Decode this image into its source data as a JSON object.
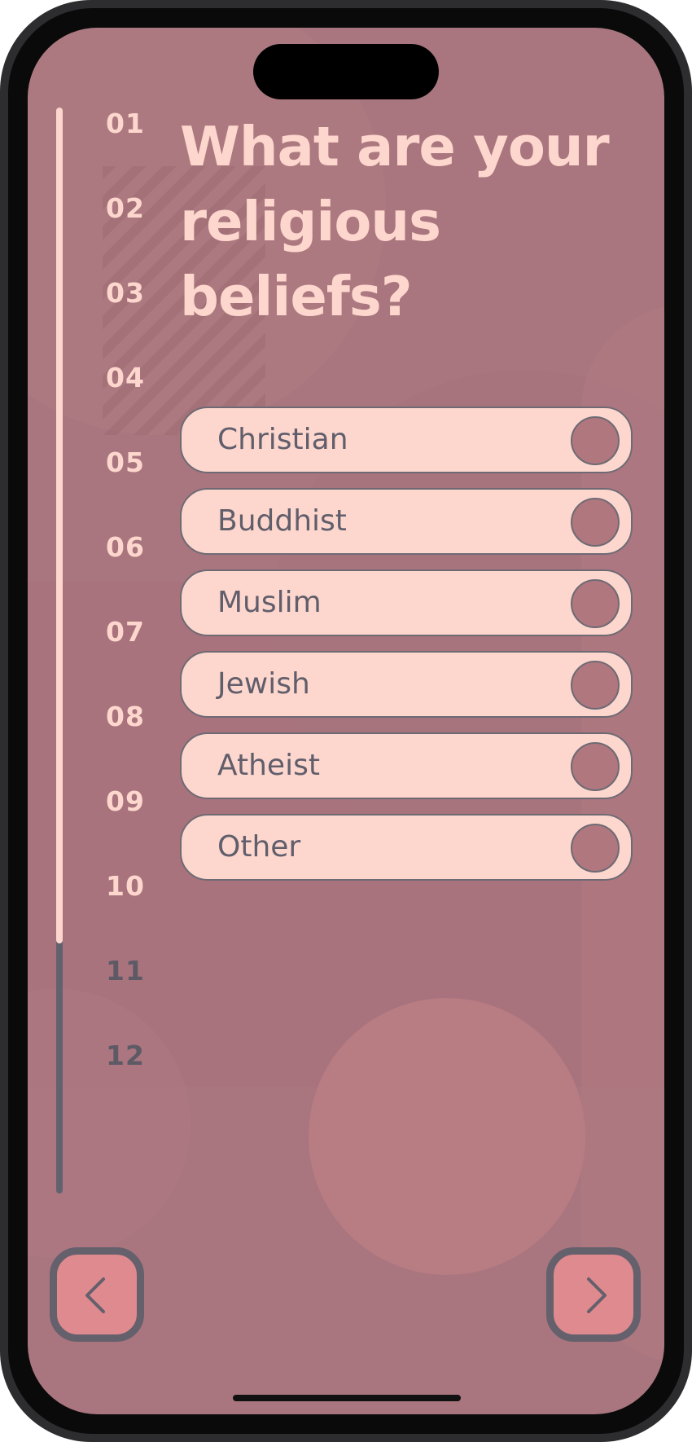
{
  "survey": {
    "question": "What are your religious beliefs?",
    "steps": [
      "01",
      "02",
      "03",
      "04",
      "05",
      "06",
      "07",
      "08",
      "09",
      "10",
      "11",
      "12"
    ],
    "current_step": 10,
    "total_steps": 12,
    "progress_fraction": 0.77,
    "options": [
      {
        "label": "Christian",
        "selected": false
      },
      {
        "label": "Buddhist",
        "selected": false
      },
      {
        "label": "Muslim",
        "selected": false
      },
      {
        "label": "Jewish",
        "selected": false
      },
      {
        "label": "Atheist",
        "selected": false
      },
      {
        "label": "Other",
        "selected": false
      }
    ]
  },
  "navigation": {
    "back_icon": "chevron-left-icon",
    "next_icon": "chevron-right-icon"
  },
  "colors": {
    "background": "#a9767f",
    "accent_text": "#fdd7cd",
    "option_background": "#fdd7cd",
    "option_text": "#615e6c",
    "radio_fill": "#b0777e",
    "nav_button_fill": "#de8a8f",
    "nav_button_border": "#64606c",
    "progress_track": "#62626e",
    "upcoming_step": "#5d5a66"
  }
}
